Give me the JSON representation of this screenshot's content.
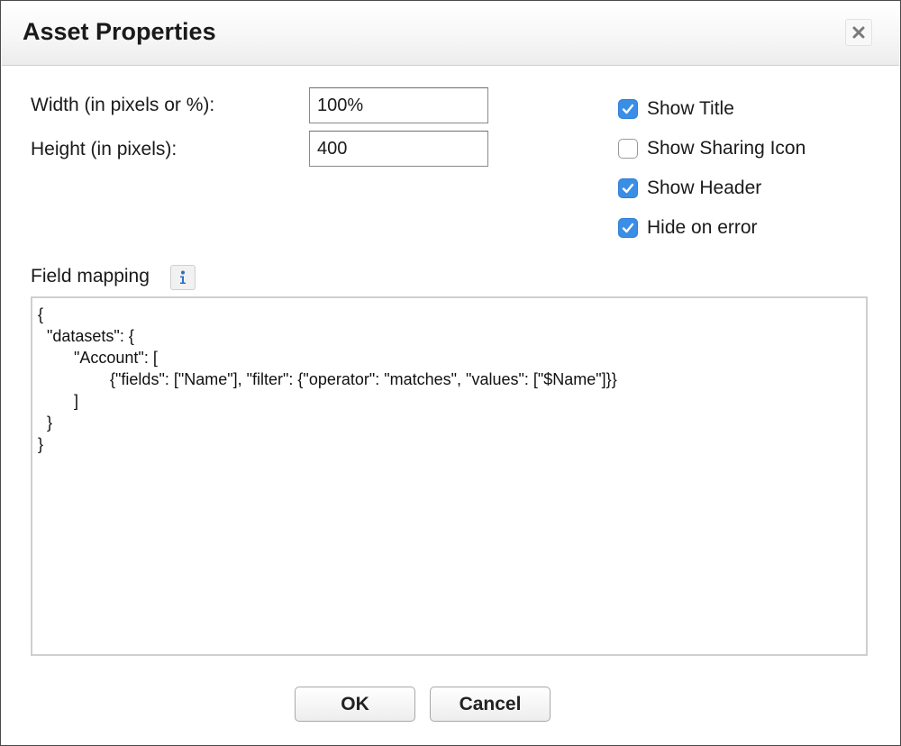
{
  "dialog": {
    "title": "Asset Properties",
    "close_icon": "close-icon"
  },
  "form": {
    "width_label": "Width (in pixels or %):",
    "width_value": "100%",
    "height_label": "Height (in pixels):",
    "height_value": "400",
    "field_mapping_label": "Field mapping",
    "info_icon": "info-icon",
    "field_mapping_value": "{\n  \"datasets\": {\n        \"Account\": [\n                {\"fields\": [\"Name\"], \"filter\": {\"operator\": \"matches\", \"values\": [\"$Name\"]}}\n        ]\n  }\n}"
  },
  "options": [
    {
      "label": "Show Title",
      "checked": true
    },
    {
      "label": "Show Sharing Icon",
      "checked": false
    },
    {
      "label": "Show Header",
      "checked": true
    },
    {
      "label": "Hide on error",
      "checked": true
    }
  ],
  "buttons": {
    "ok_label": "OK",
    "cancel_label": "Cancel"
  },
  "colors": {
    "checkbox_checked": "#3a8ee6",
    "info_icon": "#2f6fc2"
  }
}
